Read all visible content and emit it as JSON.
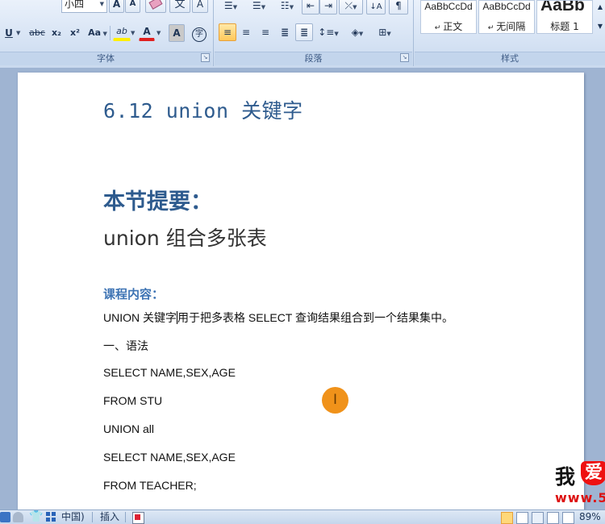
{
  "ribbon": {
    "font_group": {
      "caption": "字体",
      "font_size_value": "小四",
      "buttons": {
        "underline": "U",
        "strikethrough": "abc",
        "subscript": "x₂",
        "superscript": "x²",
        "change_case": "Aa",
        "grow_font": "A",
        "shrink_font": "A",
        "highlight": "ab",
        "font_color": "A",
        "char_shading": "A",
        "enclose_char": "字",
        "phonetic": "",
        "char_border": "A"
      }
    },
    "paragraph_group": {
      "caption": "段落"
    },
    "styles_group": {
      "caption": "样式",
      "styles": [
        {
          "sample": "AaBbCcDd",
          "name": "正文"
        },
        {
          "sample": "AaBbCcDd",
          "name": "无间隔"
        },
        {
          "sample": "AaBb",
          "name": "标题 1"
        }
      ]
    }
  },
  "document": {
    "title": "6.12 union 关键字",
    "heading": "本节提要：",
    "subheading": "union 组合多张表",
    "section_label": "课程内容：",
    "intro_before_caret": "UNION 关键字",
    "intro_after_caret": "用于把多表格 SELECT 查询结果组合到一个结果集中。",
    "lines": [
      "一、语法",
      "SELECT NAME,SEX,AGE",
      "FROM STU",
      "UNION all",
      "SELECT NAME,SEX,AGE",
      "FROM TEACHER;"
    ]
  },
  "watermark": {
    "text": "我",
    "heart_text": "爱",
    "url": "www.5"
  },
  "statusbar": {
    "language": "中国)",
    "insert_mode": "插入",
    "zoom": "89%"
  },
  "colors": {
    "heading_blue": "#2e5b8e",
    "section_blue": "#3e74b4",
    "cursor_orange": "#f0921a"
  }
}
